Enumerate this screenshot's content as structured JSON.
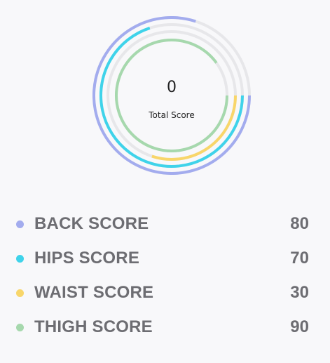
{
  "summary": {
    "total_value": "0",
    "total_label": "Total Score"
  },
  "scores": [
    {
      "label": "BACK SCORE",
      "value": 80,
      "display": "80",
      "color": "#a3acee"
    },
    {
      "label": "HIPS SCORE",
      "value": 70,
      "display": "70",
      "color": "#3fd3ea"
    },
    {
      "label": "WAIST SCORE",
      "value": 30,
      "display": "30",
      "color": "#f8d66a"
    },
    {
      "label": "THIGH SCORE",
      "value": 90,
      "display": "90",
      "color": "#a6d8ad"
    }
  ],
  "ring_track_color": "#e7e7ea"
}
